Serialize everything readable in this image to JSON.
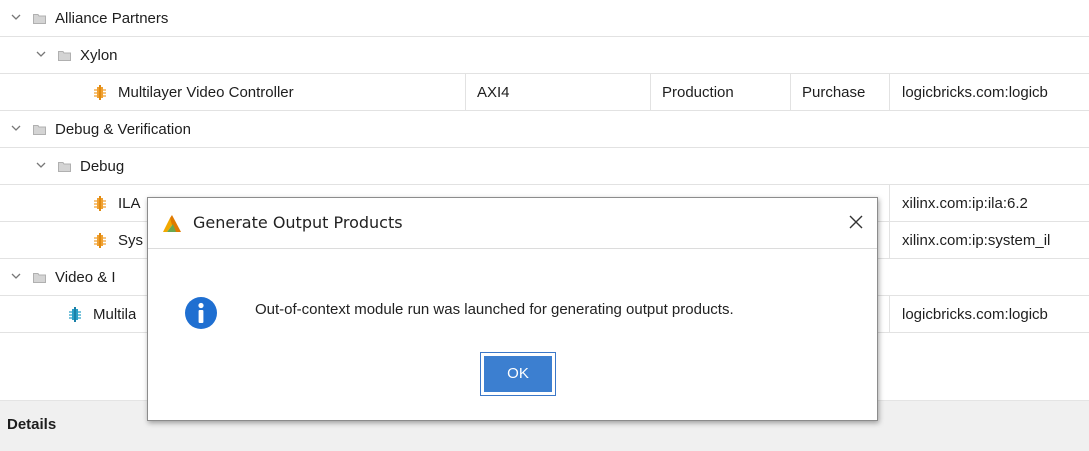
{
  "tree": {
    "rows": [
      {
        "kind": "folder",
        "name": "Alliance Partners"
      },
      {
        "kind": "folder",
        "name": "Xylon"
      },
      {
        "kind": "ip",
        "name": "Multilayer Video Controller",
        "interface": "AXI4",
        "status": "Production",
        "license": "Purchase",
        "vlnv": "logicbricks.com:logicb"
      },
      {
        "kind": "folder",
        "name": "Debug & Verification"
      },
      {
        "kind": "folder",
        "name": "Debug"
      },
      {
        "kind": "ip",
        "name": "ILA",
        "interface": "",
        "status": "",
        "license": "",
        "vlnv": "xilinx.com:ip:ila:6.2"
      },
      {
        "kind": "ip",
        "name": "Sys",
        "interface": "",
        "status": "",
        "license": "",
        "vlnv": "xilinx.com:ip:system_il"
      },
      {
        "kind": "folder",
        "name": "Video & I"
      },
      {
        "kind": "ip",
        "name": "Multila",
        "interface": "",
        "status": "",
        "license": "",
        "vlnv": "logicbricks.com:logicb"
      }
    ]
  },
  "details": {
    "label": "Details"
  },
  "dialog": {
    "title": "Generate Output Products",
    "message": "Out-of-context module run was launched for generating output products.",
    "ok_label": "OK"
  },
  "colors": {
    "accent": "#3c7fd0",
    "ip_icon": "#f0a030",
    "ip_icon_alt": "#2aa0c8"
  }
}
